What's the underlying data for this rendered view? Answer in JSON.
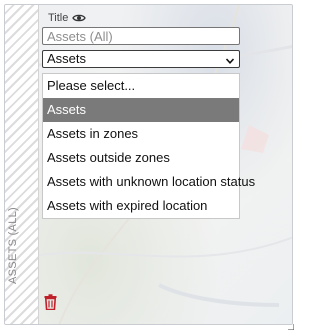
{
  "panel": {
    "side_label": "ASSETS (ALL)"
  },
  "filter": {
    "title_label": "Title",
    "title_placeholder": "Assets (All)",
    "select_value": "Assets",
    "options": [
      "Please select...",
      "Assets",
      "Assets in zones",
      "Assets outside zones",
      "Assets with unknown location status",
      "Assets with expired location"
    ],
    "selected_index": 1
  },
  "icons": {
    "visibility": "eye-icon",
    "dropdown": "chevron-down-icon",
    "delete": "trash-icon"
  },
  "colors": {
    "delete_icon": "#c0202a",
    "selected_option_bg": "#7a7a7a",
    "selected_option_text": "#ffffff"
  }
}
